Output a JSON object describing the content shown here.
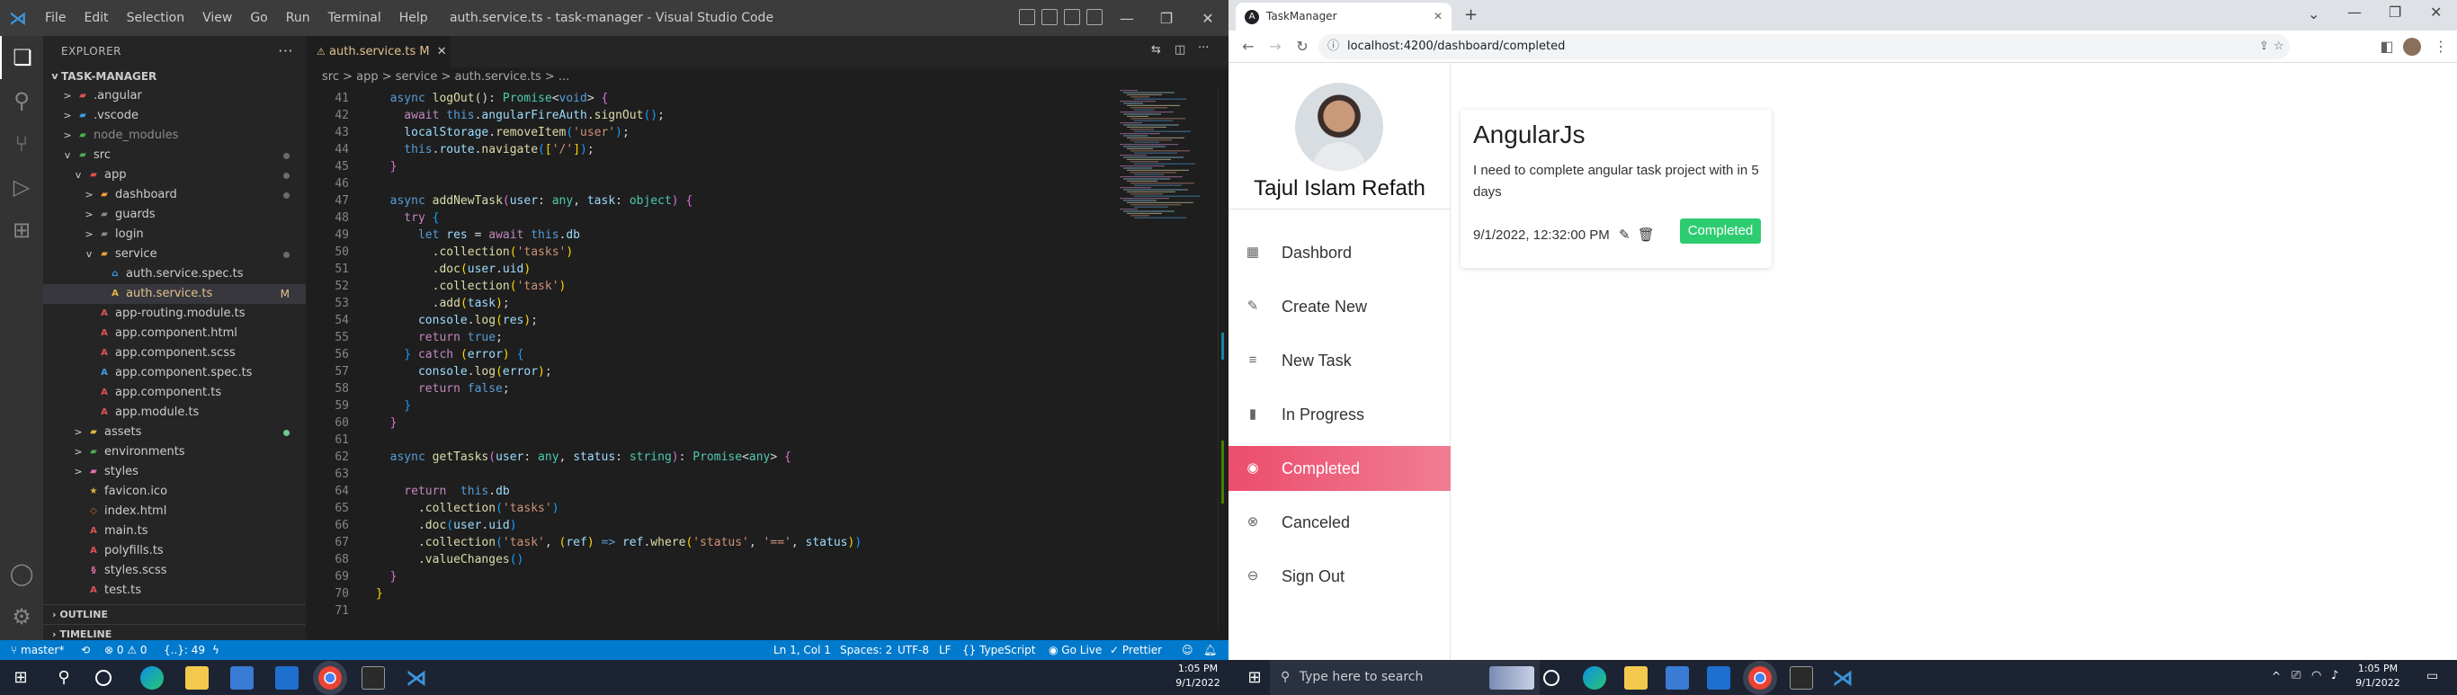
{
  "vscode": {
    "menu": [
      "File",
      "Edit",
      "Selection",
      "View",
      "Go",
      "Run",
      "Terminal",
      "Help"
    ],
    "window_title": "auth.service.ts - task-manager - Visual Studio Code",
    "explorer_label": "EXPLORER",
    "project": "TASK-MANAGER",
    "tree": [
      {
        "label": ".angular",
        "depth": 1,
        "kind": "folder-red",
        "chev": ">"
      },
      {
        "label": ".vscode",
        "depth": 1,
        "kind": "folder-blue",
        "chev": ">"
      },
      {
        "label": "node_modules",
        "depth": 1,
        "kind": "folder-green",
        "chev": ">",
        "dim": true
      },
      {
        "label": "src",
        "depth": 1,
        "kind": "folder-green",
        "chev": "v",
        "dot": "grey"
      },
      {
        "label": "app",
        "depth": 2,
        "kind": "folder-red",
        "chev": "v",
        "dot": "grey"
      },
      {
        "label": "dashboard",
        "depth": 3,
        "kind": "folder-orange",
        "chev": ">",
        "dot": "grey"
      },
      {
        "label": "guards",
        "depth": 3,
        "kind": "folder",
        "chev": ">"
      },
      {
        "label": "login",
        "depth": 3,
        "kind": "folder",
        "chev": ">"
      },
      {
        "label": "service",
        "depth": 3,
        "kind": "folder-orange",
        "chev": "v",
        "dot": "grey"
      },
      {
        "label": "auth.service.spec.ts",
        "depth": 4,
        "kind": "ts-spec"
      },
      {
        "label": "auth.service.ts",
        "depth": 4,
        "kind": "ts-service",
        "flag": "M",
        "selected": true
      },
      {
        "label": "app-routing.module.ts",
        "depth": 3,
        "kind": "ng"
      },
      {
        "label": "app.component.html",
        "depth": 3,
        "kind": "ng"
      },
      {
        "label": "app.component.scss",
        "depth": 3,
        "kind": "ng"
      },
      {
        "label": "app.component.spec.ts",
        "depth": 3,
        "kind": "ng-spec"
      },
      {
        "label": "app.component.ts",
        "depth": 3,
        "kind": "ng"
      },
      {
        "label": "app.module.ts",
        "depth": 3,
        "kind": "ng"
      },
      {
        "label": "assets",
        "depth": 2,
        "kind": "folder-yellow",
        "chev": ">",
        "dot": "green"
      },
      {
        "label": "environments",
        "depth": 2,
        "kind": "folder-green",
        "chev": ">"
      },
      {
        "label": "styles",
        "depth": 2,
        "kind": "folder-pink",
        "chev": ">"
      },
      {
        "label": "favicon.ico",
        "depth": 2,
        "kind": "star"
      },
      {
        "label": "index.html",
        "depth": 2,
        "kind": "html"
      },
      {
        "label": "main.ts",
        "depth": 2,
        "kind": "ng"
      },
      {
        "label": "polyfills.ts",
        "depth": 2,
        "kind": "ng"
      },
      {
        "label": "styles.scss",
        "depth": 2,
        "kind": "scss"
      },
      {
        "label": "test.ts",
        "depth": 2,
        "kind": "ng"
      }
    ],
    "outline_label": "OUTLINE",
    "timeline_label": "TIMELINE",
    "tab_label": "auth.service.ts",
    "tab_flag": "M",
    "breadcrumb": "src > app > service > auth.service.ts > ...",
    "code": [
      {
        "n": "41",
        "t": [
          [
            "th",
            "  async "
          ],
          [
            "fn",
            "logOut"
          ],
          [
            "pu",
            "(): "
          ],
          [
            "ty",
            "Promise"
          ],
          [
            "pu",
            "<"
          ],
          [
            "th",
            "void"
          ],
          [
            "pu",
            "> "
          ],
          [
            "br2",
            "{"
          ]
        ]
      },
      {
        "n": "42",
        "t": [
          [
            "kw",
            "    await "
          ],
          [
            "th",
            "this"
          ],
          [
            "pu",
            "."
          ],
          [
            "vr",
            "angularFireAuth"
          ],
          [
            "pu",
            "."
          ],
          [
            "fn",
            "signOut"
          ],
          [
            "br3",
            "()"
          ],
          [
            "pu",
            ";"
          ]
        ]
      },
      {
        "n": "43",
        "t": [
          [
            "vr",
            "    localStorage"
          ],
          [
            "pu",
            "."
          ],
          [
            "fn",
            "removeItem"
          ],
          [
            "br3",
            "("
          ],
          [
            "st",
            "'user'"
          ],
          [
            "br3",
            ")"
          ],
          [
            "pu",
            ";"
          ]
        ]
      },
      {
        "n": "44",
        "t": [
          [
            "th",
            "    this"
          ],
          [
            "pu",
            "."
          ],
          [
            "vr",
            "route"
          ],
          [
            "pu",
            "."
          ],
          [
            "fn",
            "navigate"
          ],
          [
            "br3",
            "("
          ],
          [
            "br1",
            "["
          ],
          [
            "st",
            "'/'"
          ],
          [
            "br1",
            "]"
          ],
          [
            "br3",
            ")"
          ],
          [
            "pu",
            ";"
          ]
        ]
      },
      {
        "n": "45",
        "t": [
          [
            "br2",
            "  }"
          ]
        ]
      },
      {
        "n": "46",
        "t": [
          [
            "pu",
            ""
          ]
        ]
      },
      {
        "n": "47",
        "t": [
          [
            "th",
            "  async "
          ],
          [
            "fn",
            "addNewTask"
          ],
          [
            "br2",
            "("
          ],
          [
            "vr",
            "user"
          ],
          [
            "pu",
            ": "
          ],
          [
            "ty",
            "any"
          ],
          [
            "pu",
            ", "
          ],
          [
            "vr",
            "task"
          ],
          [
            "pu",
            ": "
          ],
          [
            "ty",
            "object"
          ],
          [
            "br2",
            ")"
          ],
          [
            "pu",
            " "
          ],
          [
            "br2",
            "{"
          ]
        ]
      },
      {
        "n": "48",
        "t": [
          [
            "kw",
            "    try "
          ],
          [
            "br3",
            "{"
          ]
        ]
      },
      {
        "n": "49",
        "t": [
          [
            "th",
            "      let "
          ],
          [
            "vr",
            "res"
          ],
          [
            "pu",
            " = "
          ],
          [
            "kw",
            "await "
          ],
          [
            "th",
            "this"
          ],
          [
            "pu",
            "."
          ],
          [
            "vr",
            "db"
          ]
        ]
      },
      {
        "n": "50",
        "t": [
          [
            "pu",
            "        ."
          ],
          [
            "fn",
            "collection"
          ],
          [
            "br1",
            "("
          ],
          [
            "st",
            "'tasks'"
          ],
          [
            "br1",
            ")"
          ]
        ]
      },
      {
        "n": "51",
        "t": [
          [
            "pu",
            "        ."
          ],
          [
            "fn",
            "doc"
          ],
          [
            "br1",
            "("
          ],
          [
            "vr",
            "user"
          ],
          [
            "pu",
            "."
          ],
          [
            "vr",
            "uid"
          ],
          [
            "br1",
            ")"
          ]
        ]
      },
      {
        "n": "52",
        "t": [
          [
            "pu",
            "        ."
          ],
          [
            "fn",
            "collection"
          ],
          [
            "br1",
            "("
          ],
          [
            "st",
            "'task'"
          ],
          [
            "br1",
            ")"
          ]
        ]
      },
      {
        "n": "53",
        "t": [
          [
            "pu",
            "        ."
          ],
          [
            "fn",
            "add"
          ],
          [
            "br1",
            "("
          ],
          [
            "vr",
            "task"
          ],
          [
            "br1",
            ")"
          ],
          [
            "pu",
            ";"
          ]
        ]
      },
      {
        "n": "54",
        "t": [
          [
            "vr",
            "      console"
          ],
          [
            "pu",
            "."
          ],
          [
            "fn",
            "log"
          ],
          [
            "br1",
            "("
          ],
          [
            "vr",
            "res"
          ],
          [
            "br1",
            ")"
          ],
          [
            "pu",
            ";"
          ]
        ]
      },
      {
        "n": "55",
        "t": [
          [
            "kw",
            "      return "
          ],
          [
            "th",
            "true"
          ],
          [
            "pu",
            ";"
          ]
        ]
      },
      {
        "n": "56",
        "t": [
          [
            "br3",
            "    }"
          ],
          [
            "kw",
            " catch "
          ],
          [
            "br1",
            "("
          ],
          [
            "vr",
            "error"
          ],
          [
            "br1",
            ")"
          ],
          [
            "pu",
            " "
          ],
          [
            "br3",
            "{"
          ]
        ]
      },
      {
        "n": "57",
        "t": [
          [
            "vr",
            "      console"
          ],
          [
            "pu",
            "."
          ],
          [
            "fn",
            "log"
          ],
          [
            "br1",
            "("
          ],
          [
            "vr",
            "error"
          ],
          [
            "br1",
            ")"
          ],
          [
            "pu",
            ";"
          ]
        ]
      },
      {
        "n": "58",
        "t": [
          [
            "kw",
            "      return "
          ],
          [
            "th",
            "false"
          ],
          [
            "pu",
            ";"
          ]
        ]
      },
      {
        "n": "59",
        "t": [
          [
            "br3",
            "    }"
          ]
        ]
      },
      {
        "n": "60",
        "t": [
          [
            "br2",
            "  }"
          ]
        ]
      },
      {
        "n": "61",
        "t": [
          [
            "pu",
            ""
          ]
        ]
      },
      {
        "n": "62",
        "t": [
          [
            "th",
            "  async "
          ],
          [
            "fn",
            "getTasks"
          ],
          [
            "br2",
            "("
          ],
          [
            "vr",
            "user"
          ],
          [
            "pu",
            ": "
          ],
          [
            "ty",
            "any"
          ],
          [
            "pu",
            ", "
          ],
          [
            "vr",
            "status"
          ],
          [
            "pu",
            ": "
          ],
          [
            "ty",
            "string"
          ],
          [
            "br2",
            ")"
          ],
          [
            "pu",
            ": "
          ],
          [
            "ty",
            "Promise"
          ],
          [
            "pu",
            "<"
          ],
          [
            "ty",
            "any"
          ],
          [
            "pu",
            "> "
          ],
          [
            "br2",
            "{"
          ]
        ]
      },
      {
        "n": "63",
        "t": [
          [
            "pu",
            ""
          ]
        ]
      },
      {
        "n": "64",
        "t": [
          [
            "kw",
            "    return  "
          ],
          [
            "th",
            "this"
          ],
          [
            "pu",
            "."
          ],
          [
            "vr",
            "db"
          ]
        ]
      },
      {
        "n": "65",
        "t": [
          [
            "pu",
            "      ."
          ],
          [
            "fn",
            "collection"
          ],
          [
            "br3",
            "("
          ],
          [
            "st",
            "'tasks'"
          ],
          [
            "br3",
            ")"
          ]
        ]
      },
      {
        "n": "66",
        "t": [
          [
            "pu",
            "      ."
          ],
          [
            "fn",
            "doc"
          ],
          [
            "br3",
            "("
          ],
          [
            "vr",
            "user"
          ],
          [
            "pu",
            "."
          ],
          [
            "vr",
            "uid"
          ],
          [
            "br3",
            ")"
          ]
        ]
      },
      {
        "n": "67",
        "t": [
          [
            "pu",
            "      ."
          ],
          [
            "fn",
            "collection"
          ],
          [
            "br3",
            "("
          ],
          [
            "st",
            "'task'"
          ],
          [
            "pu",
            ", "
          ],
          [
            "br1",
            "("
          ],
          [
            "vr",
            "ref"
          ],
          [
            "br1",
            ")"
          ],
          [
            "th",
            " => "
          ],
          [
            "vr",
            "ref"
          ],
          [
            "pu",
            "."
          ],
          [
            "fn",
            "where"
          ],
          [
            "br1",
            "("
          ],
          [
            "st",
            "'status'"
          ],
          [
            "pu",
            ", "
          ],
          [
            "st",
            "'=='"
          ],
          [
            "pu",
            ", "
          ],
          [
            "vr",
            "status"
          ],
          [
            "br1",
            ")"
          ],
          [
            "br3",
            ")"
          ]
        ]
      },
      {
        "n": "68",
        "t": [
          [
            "pu",
            "      ."
          ],
          [
            "fn",
            "valueChanges"
          ],
          [
            "br3",
            "()"
          ]
        ]
      },
      {
        "n": "69",
        "t": [
          [
            "br2",
            "  }"
          ]
        ]
      },
      {
        "n": "70",
        "t": [
          [
            "br1",
            "}"
          ]
        ]
      },
      {
        "n": "71",
        "t": [
          [
            "pu",
            ""
          ]
        ]
      }
    ],
    "status": {
      "branch": "master*",
      "problems": "⊗ 0 ⚠ 0",
      "braces": "{..}: 49",
      "position": "Ln 1, Col 1",
      "spaces": "Spaces: 2",
      "encoding": "UTF-8",
      "eol": "LF",
      "language": "TypeScript",
      "golive": "Go Live",
      "prettier": "Prettier"
    }
  },
  "taskbar_left": {
    "clock_time": "1:05 PM",
    "clock_date": "9/1/2022"
  },
  "taskbar_right": {
    "search_placeholder": "Type here to search",
    "clock_time": "1:05 PM",
    "clock_date": "9/1/2022"
  },
  "chrome": {
    "tab_title": "TaskManager",
    "url": "localhost:4200/dashboard/completed"
  },
  "app": {
    "user_name": "Tajul Islam Refath",
    "nav": [
      {
        "label": "Dashbord",
        "icon": "dashboard-icon",
        "active": false
      },
      {
        "label": "Create New",
        "icon": "edit-icon",
        "active": false
      },
      {
        "label": "New Task",
        "icon": "list-icon",
        "active": false
      },
      {
        "label": "In Progress",
        "icon": "bar-chart-icon",
        "active": false
      },
      {
        "label": "Completed",
        "icon": "check-circle-icon",
        "active": true
      },
      {
        "label": "Canceled",
        "icon": "x-circle-icon",
        "active": false
      },
      {
        "label": "Sign Out",
        "icon": "signout-icon",
        "active": false
      }
    ],
    "task": {
      "title": "AngularJs",
      "description": "I need to complete angular task project with in 5 days",
      "date": "9/1/2022, 12:32:00 PM",
      "status": "Completed",
      "status_color": "#2ecc71"
    }
  }
}
